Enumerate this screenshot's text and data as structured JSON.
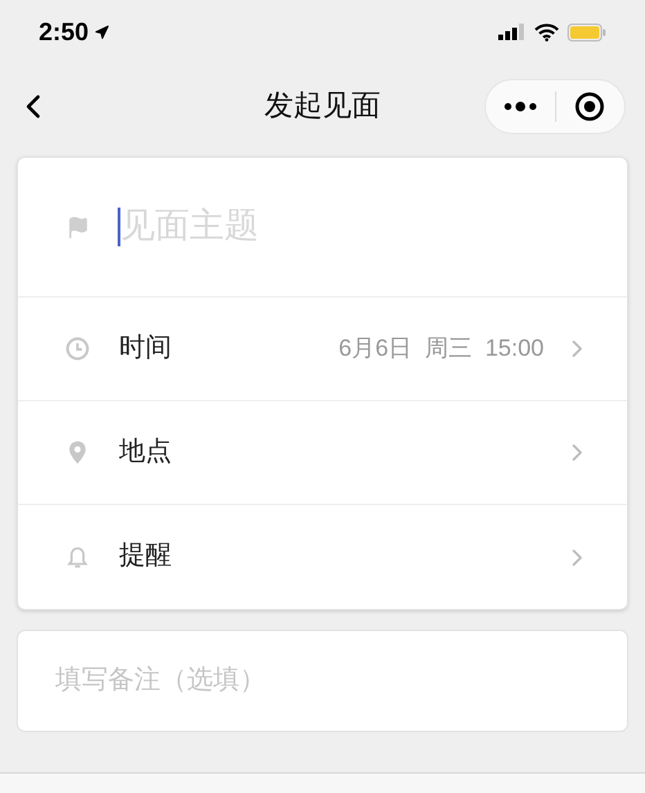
{
  "status_bar": {
    "time": "2:50"
  },
  "nav_bar": {
    "title": "发起见面"
  },
  "subject": {
    "placeholder": "见面主题",
    "focused": true
  },
  "rows": [
    {
      "label": "时间",
      "value": "6月6日  周三  15:00"
    },
    {
      "label": "地点"
    },
    {
      "label": "提醒"
    }
  ],
  "note": {
    "placeholder": "填写备注（选填）"
  }
}
